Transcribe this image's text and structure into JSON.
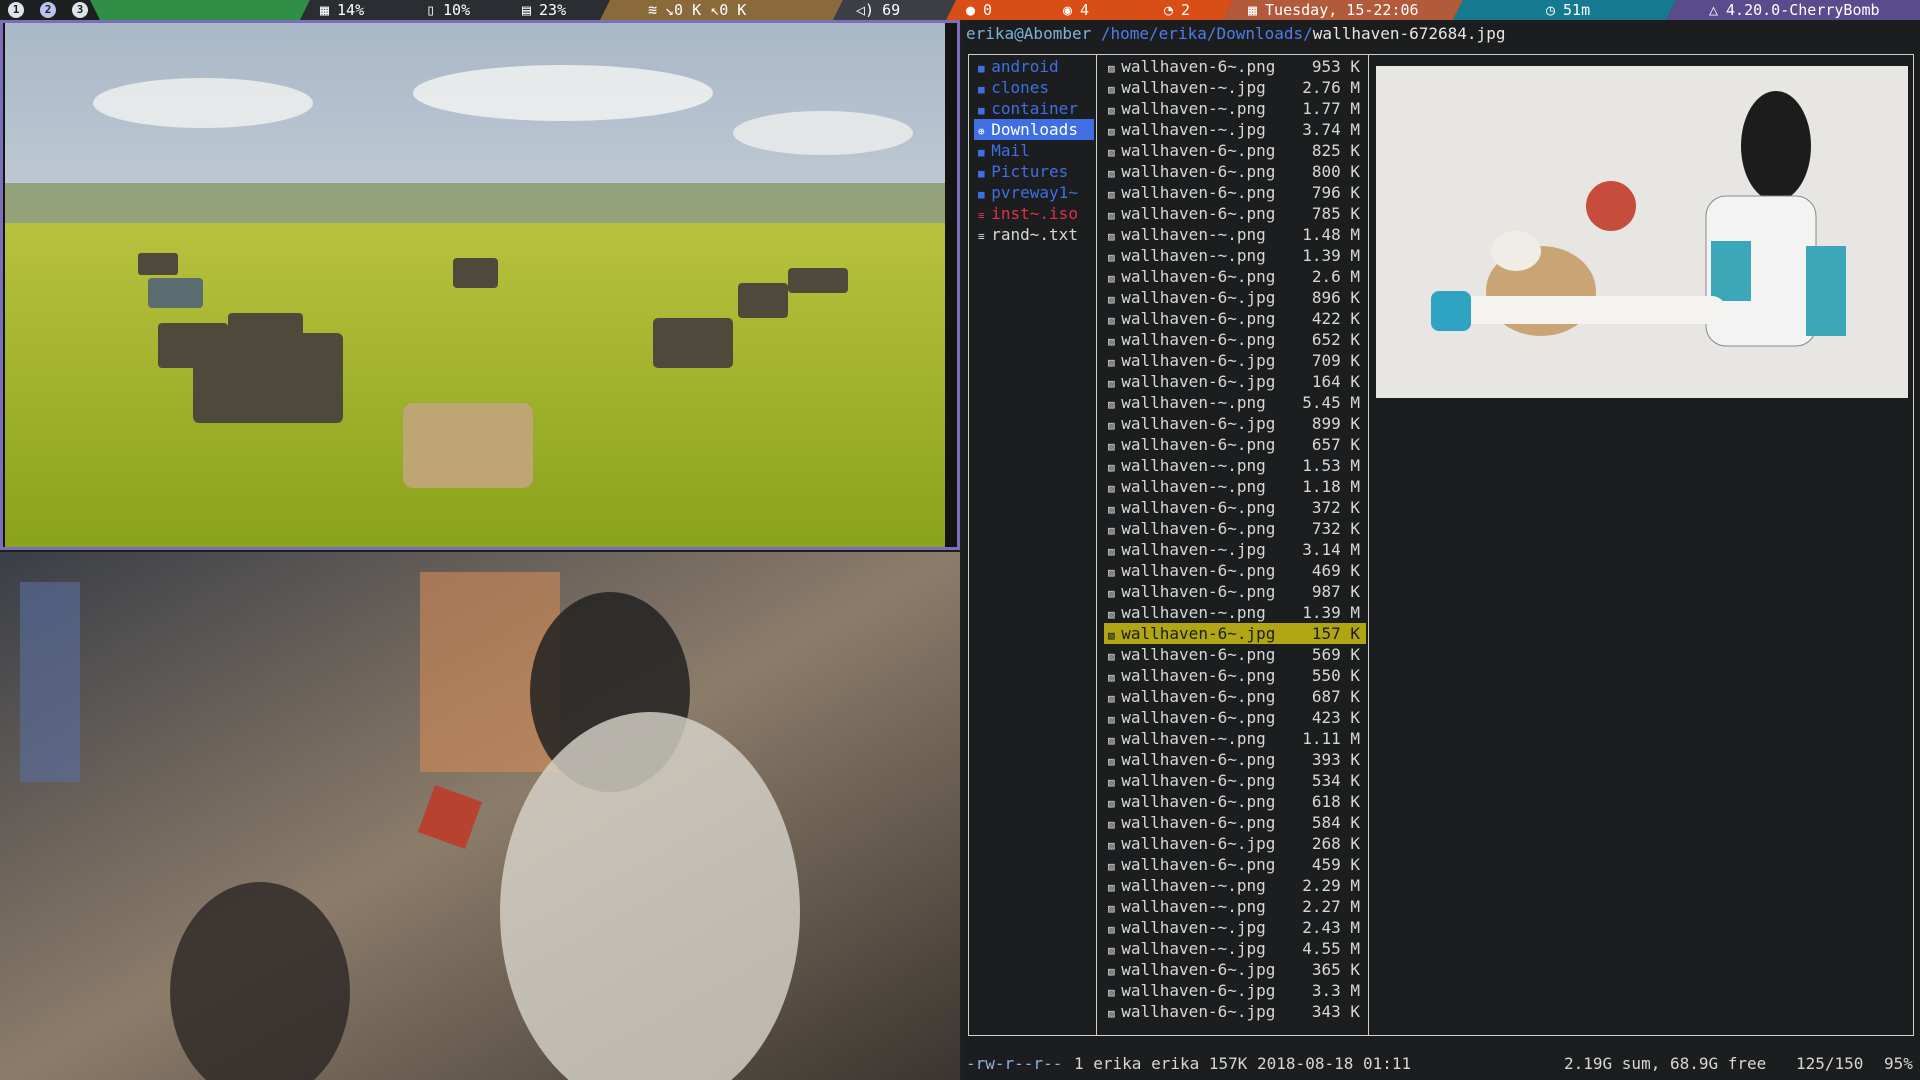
{
  "bar": {
    "workspaces": [
      "1",
      "2",
      "3"
    ],
    "cpu": "14%",
    "battery": "10%",
    "disk": "23%",
    "net_down": "↘0 K",
    "net_up": "↖0 K",
    "volume": "69",
    "github": "0",
    "reddit": "4",
    "rss": "2",
    "datetime": "Tuesday, 15-22:06",
    "timer": "51m",
    "kernel": "4.20.0-CherryBomb"
  },
  "ranger": {
    "user_host": "erika@Abomber",
    "path": "/home/erika/Downloads/",
    "selected_file": "wallhaven-672684.jpg",
    "dirs": [
      {
        "name": "android",
        "kind": "dir"
      },
      {
        "name": "clones",
        "kind": "dir"
      },
      {
        "name": "container",
        "kind": "dir"
      },
      {
        "name": "Downloads",
        "kind": "dir-selected"
      },
      {
        "name": "Mail",
        "kind": "dir"
      },
      {
        "name": "Pictures",
        "kind": "dir"
      },
      {
        "name": "pvreway1~",
        "kind": "dir"
      },
      {
        "name": "inst~.iso",
        "kind": "iso"
      },
      {
        "name": "rand~.txt",
        "kind": "txt"
      }
    ],
    "files": [
      {
        "name": "wallhaven-6~.png",
        "size": "953 K"
      },
      {
        "name": "wallhaven-~.jpg",
        "size": "2.76 M"
      },
      {
        "name": "wallhaven-~.png",
        "size": "1.77 M"
      },
      {
        "name": "wallhaven-~.jpg",
        "size": "3.74 M"
      },
      {
        "name": "wallhaven-6~.png",
        "size": "825 K"
      },
      {
        "name": "wallhaven-6~.png",
        "size": "800 K"
      },
      {
        "name": "wallhaven-6~.png",
        "size": "796 K"
      },
      {
        "name": "wallhaven-6~.png",
        "size": "785 K"
      },
      {
        "name": "wallhaven-~.png",
        "size": "1.48 M"
      },
      {
        "name": "wallhaven-~.png",
        "size": "1.39 M"
      },
      {
        "name": "wallhaven-6~.png",
        "size": "2.6 M"
      },
      {
        "name": "wallhaven-6~.jpg",
        "size": "896 K"
      },
      {
        "name": "wallhaven-6~.png",
        "size": "422 K"
      },
      {
        "name": "wallhaven-6~.png",
        "size": "652 K"
      },
      {
        "name": "wallhaven-6~.jpg",
        "size": "709 K"
      },
      {
        "name": "wallhaven-6~.jpg",
        "size": "164 K"
      },
      {
        "name": "wallhaven-~.png",
        "size": "5.45 M"
      },
      {
        "name": "wallhaven-6~.jpg",
        "size": "899 K"
      },
      {
        "name": "wallhaven-6~.png",
        "size": "657 K"
      },
      {
        "name": "wallhaven-~.png",
        "size": "1.53 M"
      },
      {
        "name": "wallhaven-~.png",
        "size": "1.18 M"
      },
      {
        "name": "wallhaven-6~.png",
        "size": "372 K"
      },
      {
        "name": "wallhaven-6~.png",
        "size": "732 K"
      },
      {
        "name": "wallhaven-~.jpg",
        "size": "3.14 M"
      },
      {
        "name": "wallhaven-6~.png",
        "size": "469 K"
      },
      {
        "name": "wallhaven-6~.png",
        "size": "987 K"
      },
      {
        "name": "wallhaven-~.png",
        "size": "1.39 M"
      },
      {
        "name": "wallhaven-6~.jpg",
        "size": "157 K",
        "selected": true
      },
      {
        "name": "wallhaven-6~.png",
        "size": "569 K"
      },
      {
        "name": "wallhaven-6~.png",
        "size": "550 K"
      },
      {
        "name": "wallhaven-6~.png",
        "size": "687 K"
      },
      {
        "name": "wallhaven-6~.png",
        "size": "423 K"
      },
      {
        "name": "wallhaven-~.png",
        "size": "1.11 M"
      },
      {
        "name": "wallhaven-6~.png",
        "size": "393 K"
      },
      {
        "name": "wallhaven-6~.png",
        "size": "534 K"
      },
      {
        "name": "wallhaven-6~.png",
        "size": "618 K"
      },
      {
        "name": "wallhaven-6~.png",
        "size": "584 K"
      },
      {
        "name": "wallhaven-6~.jpg",
        "size": "268 K"
      },
      {
        "name": "wallhaven-6~.png",
        "size": "459 K"
      },
      {
        "name": "wallhaven-~.png",
        "size": "2.29 M"
      },
      {
        "name": "wallhaven-~.png",
        "size": "2.27 M"
      },
      {
        "name": "wallhaven-~.jpg",
        "size": "2.43 M"
      },
      {
        "name": "wallhaven-~.jpg",
        "size": "4.55 M"
      },
      {
        "name": "wallhaven-6~.jpg",
        "size": "365 K"
      },
      {
        "name": "wallhaven-6~.jpg",
        "size": "3.3 M"
      },
      {
        "name": "wallhaven-6~.jpg",
        "size": "343 K"
      }
    ],
    "status_perms": "-rw-r--r--",
    "status_info": "1 erika erika 157K 2018-08-18 01:11",
    "status_disk": "2.19G sum, 68.9G free",
    "status_pos": "125/150",
    "status_pct": "95%"
  },
  "colors": {
    "dir": "#3f6fe3",
    "iso": "#e2304a",
    "selected_file_bg": "#b0a513",
    "path_blue": "#4f7ee8",
    "user_host": "#7cb3d9"
  }
}
